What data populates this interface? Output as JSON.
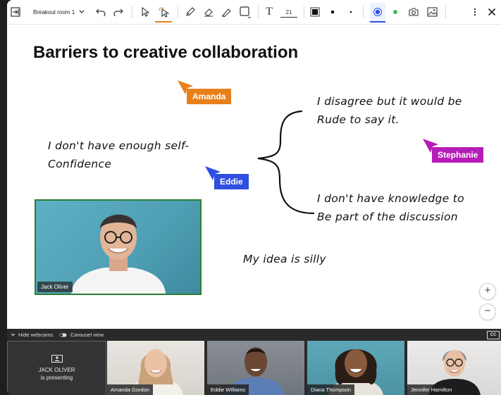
{
  "toolbar": {
    "room_select": "Breakout room 1",
    "font_size": "21"
  },
  "board": {
    "title": "Barriers to creative collaboration",
    "notes": {
      "left_line1": "I don't have enough self-",
      "left_line2": "Confidence",
      "right1_line1": "I disagree but it would be",
      "right1_line2": "Rude to say it.",
      "right2_line1": "I don't have knowledge to",
      "right2_line2": "Be part of the discussion",
      "bottom": "My idea is silly"
    },
    "cursors": [
      {
        "name": "Amanda",
        "color": "#e8801a"
      },
      {
        "name": "Eddie",
        "color": "#2f4fe0"
      },
      {
        "name": "Stephanie",
        "color": "#b51cb8"
      }
    ],
    "video_name": "Jack Oliver"
  },
  "zoom": {
    "in": "+",
    "out": "−"
  },
  "bottom_bar": {
    "hide_webcams": "Hide webcams",
    "carousel_view": "Carousel view",
    "cc": "CC",
    "presenter_name": "JACK OLIVER",
    "presenter_status": "is presenting",
    "participants": [
      "Amanda Gordon",
      "Eddie Williams",
      "Diana Thompson",
      "Jennifer Hamilton"
    ]
  },
  "colors": {
    "accent_orange": "#e8801a",
    "accent_blue": "#2f4fe0",
    "accent_magenta": "#b51cb8",
    "video_border": "#2e7d32"
  }
}
